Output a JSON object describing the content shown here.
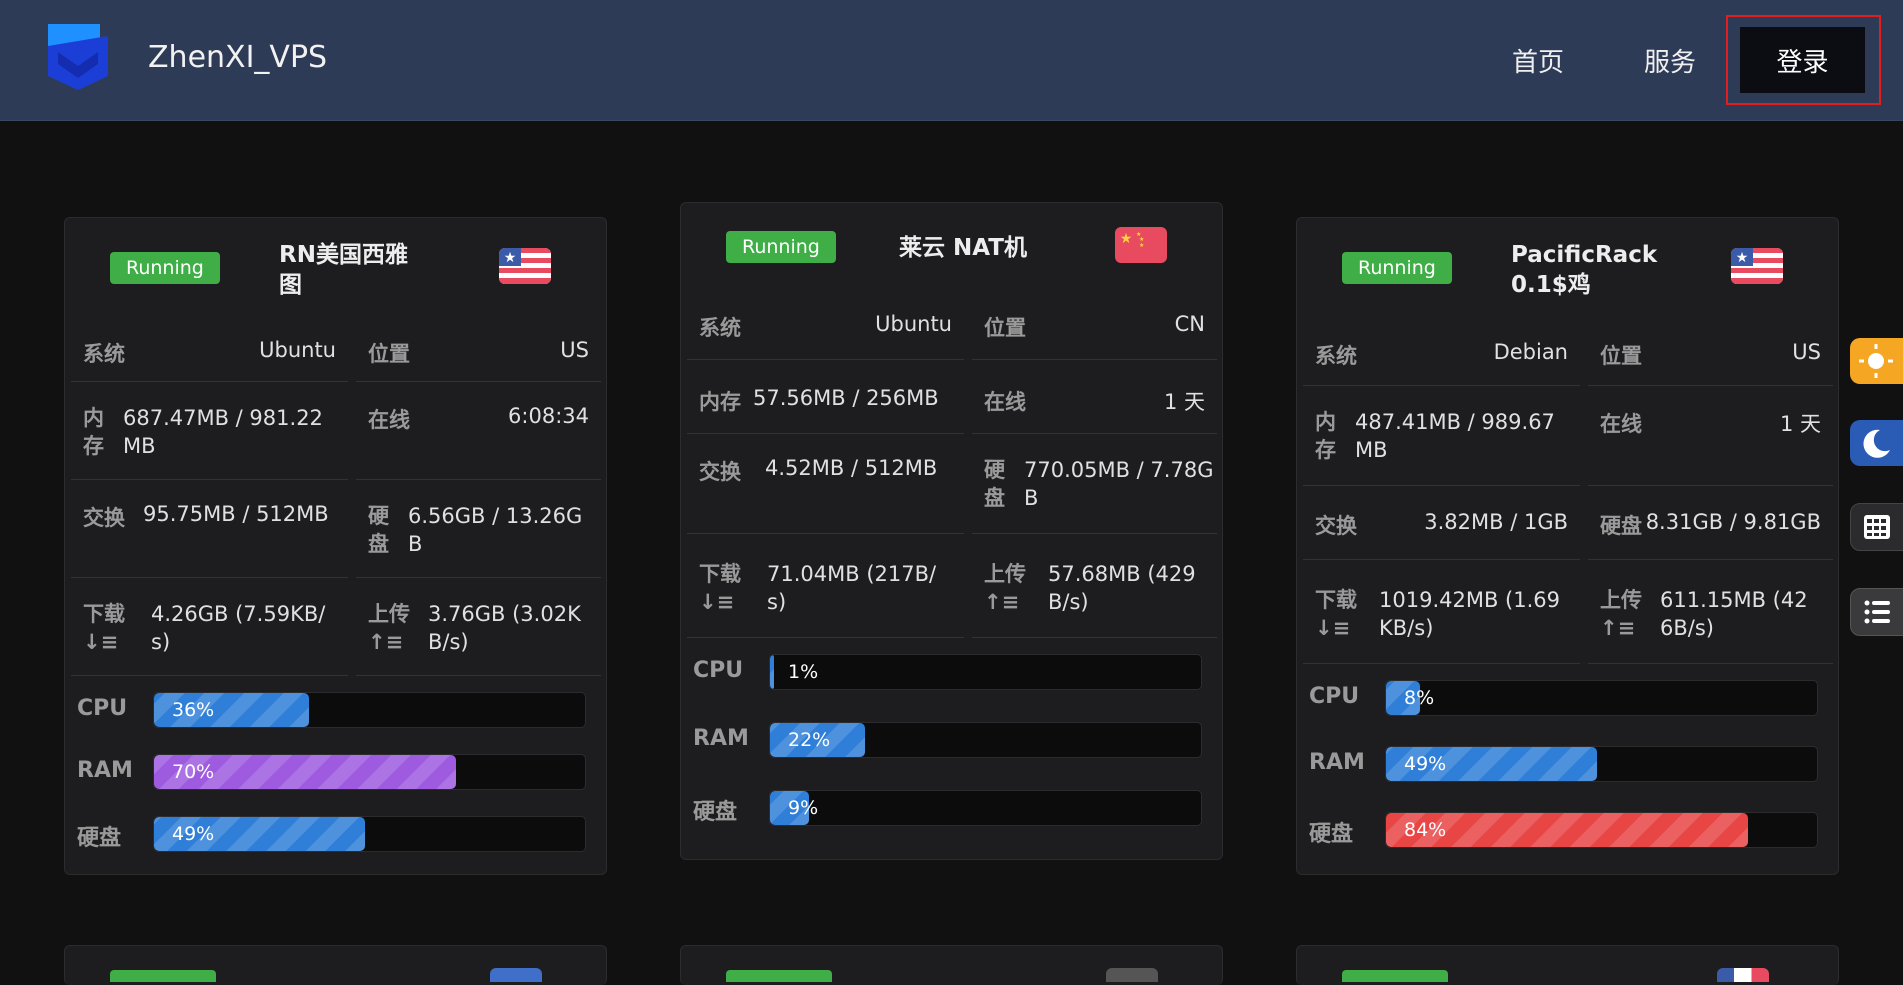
{
  "header": {
    "brand": "ZhenXI_VPS",
    "nav": [
      {
        "label": "首页"
      },
      {
        "label": "服务"
      }
    ],
    "login_label": "登录"
  },
  "cards": [
    {
      "status": "Running",
      "name": "RN美国西雅图",
      "flag": "us-flag",
      "system_label": "系统",
      "system": "Ubuntu",
      "location_label": "位置",
      "location": "US",
      "memory_label": "内存",
      "memory": "687.47MB / 981.22 MB",
      "online_label": "在线",
      "online": "6:08:34",
      "swap_label": "交换",
      "swap": "95.75MB / 512MB",
      "disk_label": "硬盘",
      "disk": "6.56GB / 13.26GB",
      "down_label": "下载",
      "down": "4.26GB (7.59KB/s)",
      "up_label": "上传",
      "up": "3.76GB (3.02KB/s)",
      "cpu_label": "CPU",
      "cpu": 36,
      "cpu_text": "36%",
      "ram_label": "RAM",
      "ram": 70,
      "ram_text": "70%",
      "hdd_label": "硬盘",
      "hdd": 49,
      "hdd_text": "49%",
      "ram_color": "#9e5be0"
    },
    {
      "status": "Running",
      "name": "莱云 NAT机",
      "flag": "cn-flag",
      "system_label": "系统",
      "system": "Ubuntu",
      "location_label": "位置",
      "location": "CN",
      "memory_label": "内存",
      "memory": "57.56MB / 256MB",
      "online_label": "在线",
      "online": "1 天",
      "swap_label": "交换",
      "swap": "4.52MB / 512MB",
      "disk_label": "硬盘",
      "disk": "770.05MB / 7.78GB",
      "down_label": "下载",
      "down": "71.04MB (217B/s)",
      "up_label": "上传",
      "up": "57.68MB (429B/s)",
      "cpu_label": "CPU",
      "cpu": 1,
      "cpu_text": "1%",
      "ram_label": "RAM",
      "ram": 22,
      "ram_text": "22%",
      "hdd_label": "硬盘",
      "hdd": 9,
      "hdd_text": "9%",
      "ram_color": "#2f7fd8"
    },
    {
      "status": "Running",
      "name": "PacificRack 0.1$鸡",
      "flag": "us-flag",
      "system_label": "系统",
      "system": "Debian",
      "location_label": "位置",
      "location": "US",
      "memory_label": "内存",
      "memory": "487.41MB / 989.67 MB",
      "online_label": "在线",
      "online": "1 天",
      "swap_label": "交换",
      "swap": "3.82MB / 1GB",
      "disk_label": "硬盘",
      "disk": "8.31GB / 9.81GB",
      "down_label": "下载",
      "down": "1019.42MB (1.69KB/s)",
      "up_label": "上传",
      "up": "611.15MB (426B/s)",
      "cpu_label": "CPU",
      "cpu": 8,
      "cpu_text": "8%",
      "ram_label": "RAM",
      "ram": 49,
      "ram_text": "49%",
      "hdd_label": "硬盘",
      "hdd": 84,
      "hdd_text": "84%",
      "ram_color": "#2f7fd8",
      "hdd_color": "#e84545"
    }
  ],
  "colors": {
    "header": "#2e3b56",
    "running": "#3fae47",
    "blue_bar": "#2f7fd8"
  },
  "side_tools": [
    "sun-icon",
    "moon-icon",
    "calculator-icon",
    "list-icon"
  ]
}
